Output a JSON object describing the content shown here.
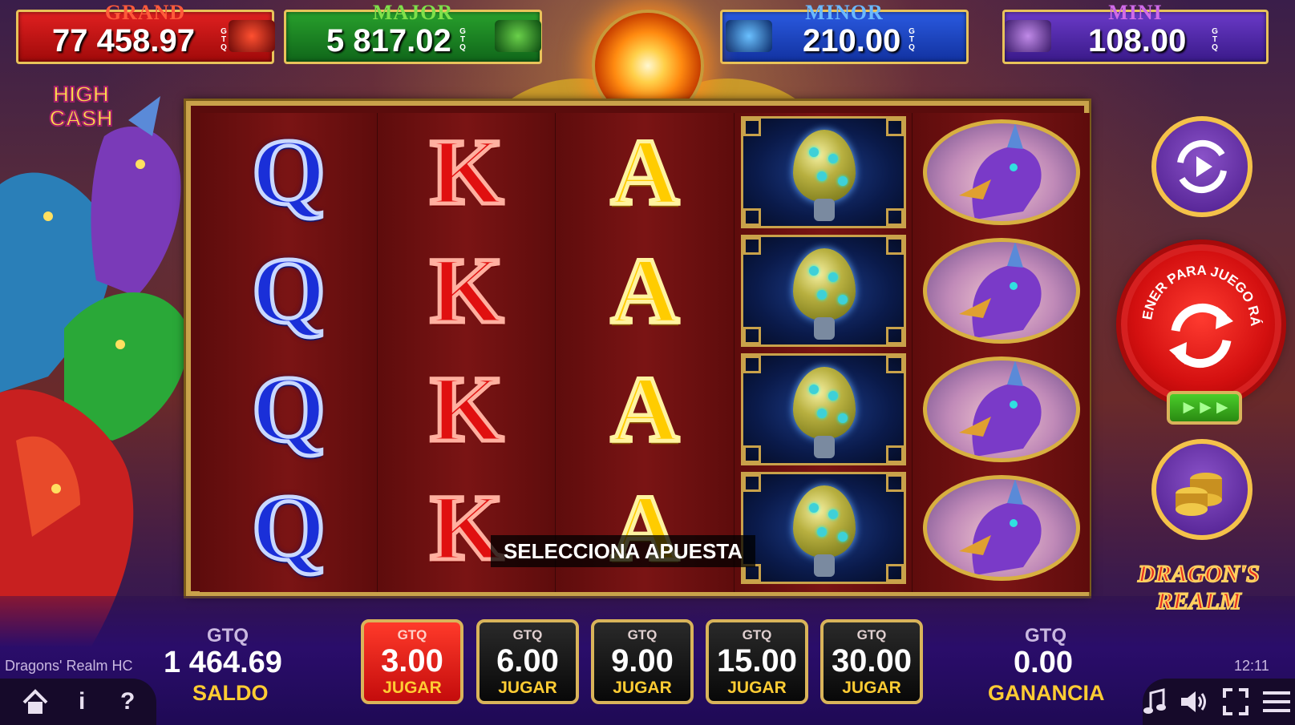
{
  "jackpots": [
    {
      "name": "GRAND",
      "value": "77 458.97",
      "currency": "GTQ",
      "color": "#d01818",
      "title_color": "#ff5a3a"
    },
    {
      "name": "MAJOR",
      "value": "5 817.02",
      "currency": "GTQ",
      "color": "#1e8a22",
      "title_color": "#7ee04a"
    },
    {
      "name": "MINOR",
      "value": "210.00",
      "currency": "GTQ",
      "color": "#2048c8",
      "title_color": "#6ab8ff"
    },
    {
      "name": "MINI",
      "value": "108.00",
      "currency": "GTQ",
      "color": "#5a2ab8",
      "title_color": "#d06ae8"
    }
  ],
  "branding": {
    "high_cash_line1": "HIGH",
    "high_cash_line2": "CASH",
    "logo_line1": "DRAGON'S",
    "logo_line2": "REALM"
  },
  "reels": [
    {
      "symbol": "Q",
      "type": "letter"
    },
    {
      "symbol": "K",
      "type": "letter"
    },
    {
      "symbol": "A",
      "type": "letter"
    },
    {
      "symbol": "dragon-egg",
      "type": "image"
    },
    {
      "symbol": "purple-dragon",
      "type": "image"
    }
  ],
  "message": "SELECCIONA APUESTA",
  "balance": {
    "currency": "GTQ",
    "value": "1 464.69",
    "label": "SALDO"
  },
  "win": {
    "currency": "GTQ",
    "value": "0.00",
    "label": "GANANCIA"
  },
  "bets": [
    {
      "currency": "GTQ",
      "amount": "3.00",
      "label": "JUGAR",
      "selected": true
    },
    {
      "currency": "GTQ",
      "amount": "6.00",
      "label": "JUGAR",
      "selected": false
    },
    {
      "currency": "GTQ",
      "amount": "9.00",
      "label": "JUGAR",
      "selected": false
    },
    {
      "currency": "GTQ",
      "amount": "15.00",
      "label": "JUGAR",
      "selected": false
    },
    {
      "currency": "GTQ",
      "amount": "30.00",
      "label": "JUGAR",
      "selected": false
    }
  ],
  "spin_button_text": "MANTENER PARA JUEGO RÁPIDO",
  "turbo_label": "►►►",
  "game_name": "Dragons' Realm HC",
  "clock": "12:11",
  "toolbar_left": {
    "info": "i",
    "help": "?"
  },
  "icons": [
    "home-icon",
    "info-icon",
    "help-icon",
    "music-icon",
    "sound-icon",
    "fullscreen-icon",
    "menu-icon",
    "autoplay-icon",
    "spin-icon",
    "coins-icon"
  ]
}
